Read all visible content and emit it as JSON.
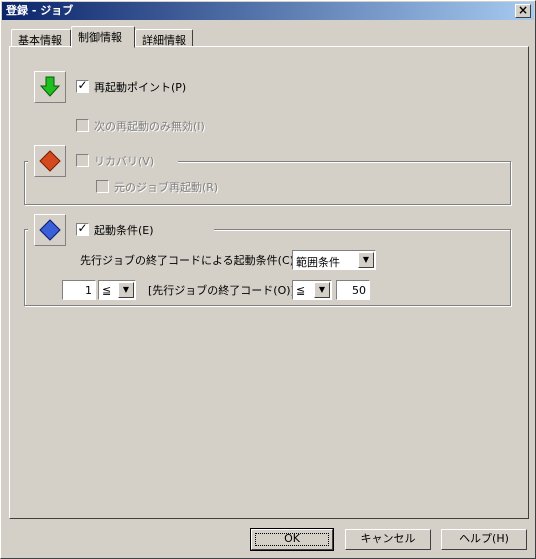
{
  "window": {
    "title": "登録 - ジョブ",
    "close_label": "×"
  },
  "tabs": [
    {
      "label": "基本情報"
    },
    {
      "label": "制御情報"
    },
    {
      "label": "詳細情報"
    }
  ],
  "restart": {
    "checkbox_label": "再起動ポイント(P)",
    "checked": true,
    "disable_next_label": "次の再起動のみ無効(I)",
    "disable_next_checked": false
  },
  "recovery": {
    "checkbox_label": "リカバリ(V)",
    "checked": false,
    "restart_original_label": "元のジョブ再起動(R)",
    "restart_original_checked": false
  },
  "start_condition": {
    "checkbox_label": "起動条件(E)",
    "checked": true,
    "condition_label": "先行ジョブの終了コードによる起動条件(C):",
    "condition_value": "範囲条件",
    "min_value": "1",
    "min_operator": "≦",
    "middle_label": "[先行ジョブの終了コード(O)]",
    "max_operator": "≦",
    "max_value": "50"
  },
  "buttons": {
    "ok": "OK",
    "cancel": "キャンセル",
    "help": "ヘルプ(H)"
  },
  "icons": {
    "restart": "green-down-arrow-icon",
    "recovery": "red-diamond-icon",
    "start_condition": "blue-diamond-icon"
  },
  "colors": {
    "titlebar_start": "#0a246a",
    "titlebar_end": "#a6caf0",
    "green_arrow": "#1fbf1f",
    "red_diamond": "#d24a1e",
    "blue_diamond": "#3a5fd8"
  }
}
